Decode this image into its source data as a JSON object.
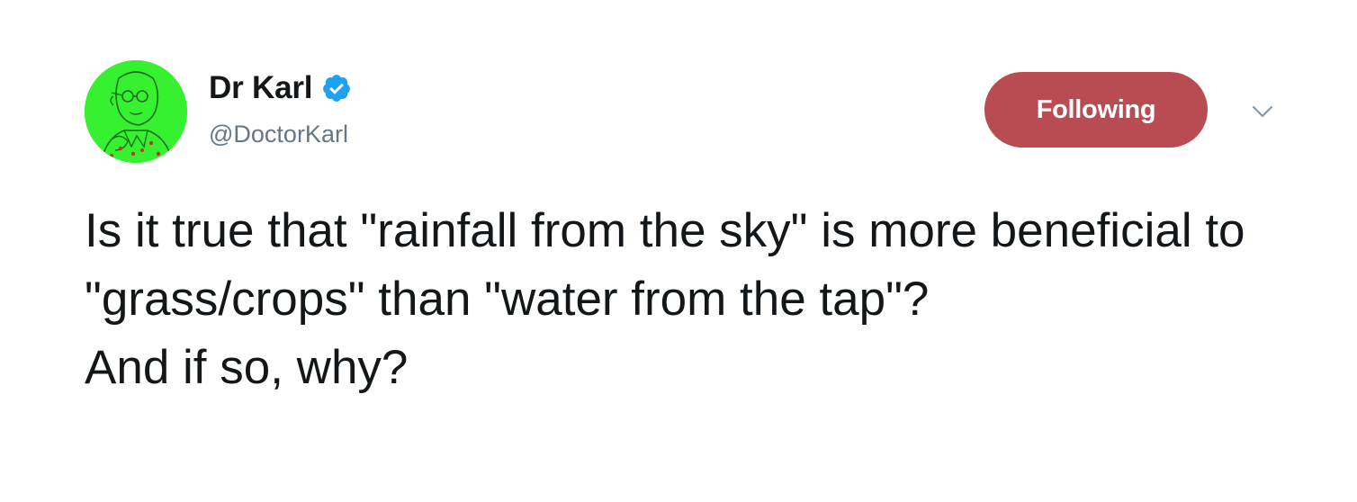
{
  "author": {
    "display_name": "Dr Karl",
    "handle": "@DoctorKarl",
    "verified": true,
    "avatar_icon": "cartoon-face-avatar",
    "avatar_color": "#35f12f"
  },
  "follow_button": {
    "label": "Following",
    "color": "#b84c52"
  },
  "menu": {
    "icon": "chevron-down-icon"
  },
  "tweet": {
    "text": "Is it true that \"rainfall from the sky\" is more beneficial to \"grass/crops\" than \"water from the tap\"?\nAnd if so, why?"
  },
  "colors": {
    "verified": "#1da1f2",
    "secondary_text": "#657786",
    "primary_text": "#14171a"
  }
}
